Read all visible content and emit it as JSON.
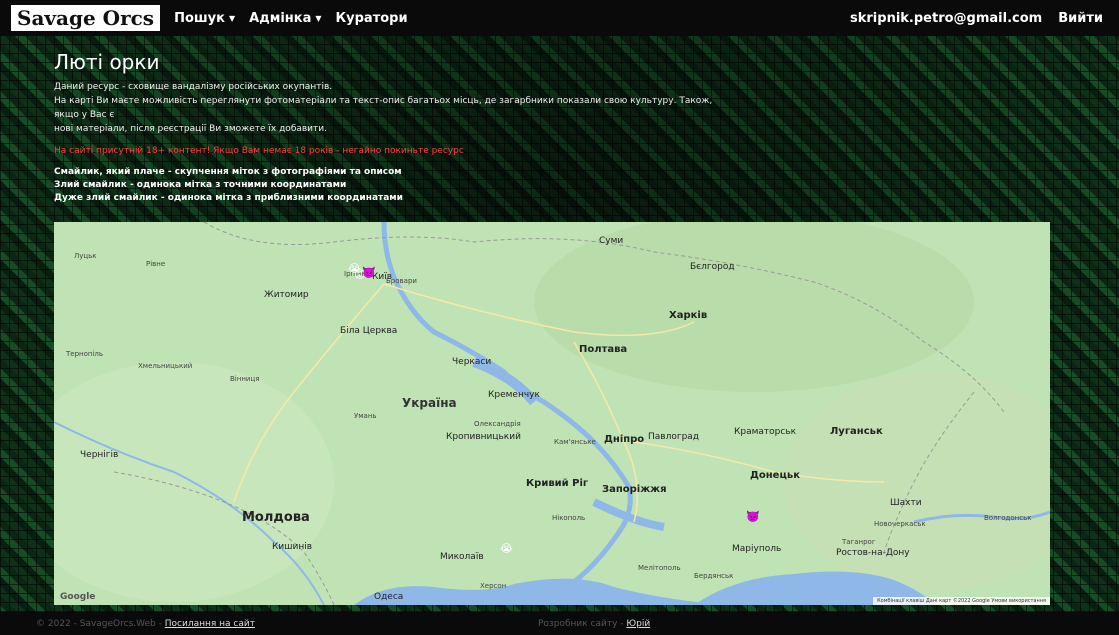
{
  "navbar": {
    "brand": "Savage Orcs",
    "search": "Пошук",
    "admin": "Адмінка",
    "curators": "Куратори",
    "user_email": "skripnik.petro@gmail.com",
    "logout": "Вийти"
  },
  "main": {
    "title": "Люті орки",
    "description": [
      "Даний ресурс - сховище вандалізму російських окупантів.",
      "На карті Ви маєте можливість переглянути фотоматеріали та текст-опис багатьох місць, де загарбники показали свою культуру. Також, якщо у Вас є",
      "нові матеріали, після реєстрації Ви зможете їх добавити."
    ],
    "warning": "На сайті присутній 18+ контент! Якщо Вам немає 18 років - негайно покиньте ресурс",
    "legend": [
      "Смайлик, який плаче - скупчення міток з фотографіями та описом",
      "Злий смайлик - одинока мітка з точними координатами",
      "Дуже злий смайлик - одинока мітка з приблизними координатами"
    ]
  },
  "map": {
    "country": "Україна",
    "cities_big": [
      "Харків",
      "Полтава",
      "Дніпро",
      "Запоріжжя",
      "Кривий Ріг",
      "Миколаїв",
      "Маріуполь",
      "Донецьк",
      "Луганськ",
      "Молдова",
      "Кишинів",
      "Ростов-на-Дону"
    ],
    "cities": [
      "Київ",
      "Житомир",
      "Біла Церква",
      "Вінниця",
      "Умань",
      "Черкаси",
      "Кременчук",
      "Кропивницький",
      "Олександрія",
      "Кам'янське",
      "Павлоград",
      "Краматорськ",
      "Суми",
      "Бєлгород",
      "Чернігів",
      "Херсон",
      "Одеса",
      "Бердянськ",
      "Мелітополь",
      "Нікополь",
      "Рівне",
      "Луцьк",
      "Тернопіль",
      "Хмельницький",
      "Бровари",
      "Ірпінь",
      "Шахти",
      "Таганрог",
      "Новочеркаськ",
      "Волгодонськ"
    ],
    "google_label": "Google",
    "attribution": "Комбінації клавіш   Дані карт ©2022 Google   Умови використання"
  },
  "footer": {
    "copyright": "© 2022 - SavageOrcs.Web -",
    "site_link": "Посилання на сайт",
    "developer_label": "Розробник сайту -",
    "developer_name": "Юрій"
  },
  "colors": {
    "warning": "#ff4040",
    "map_land": "#bfe3b4",
    "water": "#8fb8e8"
  }
}
